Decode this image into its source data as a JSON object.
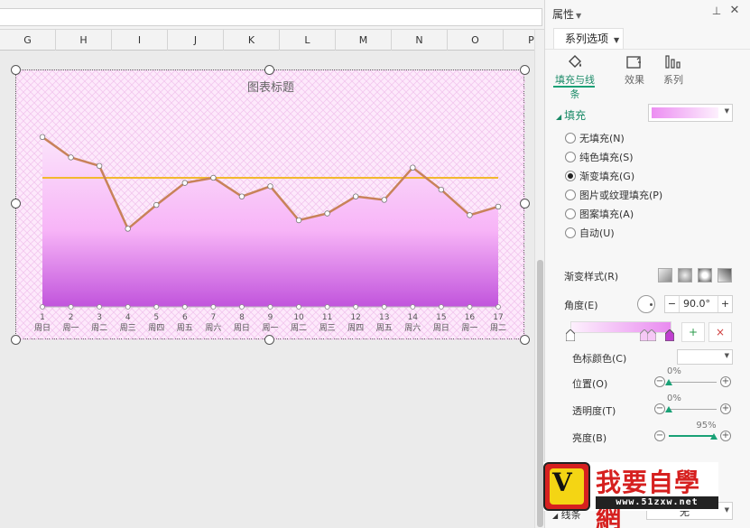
{
  "columns": [
    "G",
    "H",
    "I",
    "J",
    "K",
    "L",
    "M",
    "N",
    "O",
    "P"
  ],
  "chart_data": {
    "type": "area",
    "title": "图表标题",
    "categories": [
      "1",
      "2",
      "3",
      "4",
      "5",
      "6",
      "7",
      "8",
      "9",
      "10",
      "11",
      "12",
      "13",
      "14",
      "15",
      "16",
      "17"
    ],
    "sub_categories": [
      "周日",
      "周一",
      "周二",
      "周三",
      "周四",
      "周五",
      "周六",
      "周日",
      "周一",
      "周二",
      "周三",
      "周四",
      "周五",
      "周六",
      "周日",
      "周一",
      "周二"
    ],
    "series": [
      {
        "values": [
          100,
          88,
          83,
          46,
          60,
          73,
          76,
          65,
          71,
          51,
          55,
          65,
          63,
          82,
          69,
          54,
          59
        ],
        "type": "area-line"
      },
      {
        "values": [
          76,
          76,
          76,
          76,
          76,
          76,
          76,
          76,
          76,
          76,
          76,
          76,
          76,
          76,
          76,
          76,
          76
        ],
        "type": "line"
      }
    ],
    "ylim": [
      0,
      110
    ],
    "colors": {
      "line": "#c8825a",
      "avg": "#f2b82f",
      "fill_top": "#fbe4fb",
      "fill_bottom": "#c154dc"
    }
  },
  "panel": {
    "title": "属性",
    "series_tab": "系列选项",
    "tabs": [
      {
        "label": "填充与线条",
        "icon": "paint-bucket-icon"
      },
      {
        "label": "效果",
        "icon": "effects-icon"
      },
      {
        "label": "系列",
        "icon": "series-bars-icon"
      }
    ],
    "fill_section": "填充",
    "fill_options": [
      "无填充(N)",
      "纯色填充(S)",
      "渐变填充(G)",
      "图片或纹理填充(P)",
      "图案填充(A)",
      "自动(U)"
    ],
    "selected_fill": "渐变填充(G)",
    "gradient_style_label": "渐变样式(R)",
    "angle_label": "角度(E)",
    "angle_value": "90.0°",
    "stop_color_label": "色标颜色(C)",
    "position_label": "位置(O)",
    "position_value": "0%",
    "transparency_label": "透明度(T)",
    "transparency_value": "0%",
    "brightness_label": "亮度(B)",
    "brightness_value": "95%",
    "brightness_fraction": 0.95,
    "line_label": "线条",
    "line_value": "无"
  },
  "watermark": {
    "title": "我要自學網",
    "url": "www.51zxw.net"
  }
}
